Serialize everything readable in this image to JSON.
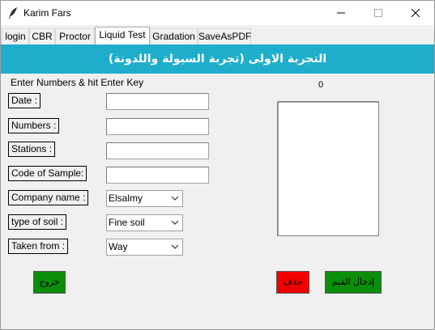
{
  "window": {
    "title": "Karim Fars"
  },
  "tabs": [
    {
      "label": "login",
      "active": false
    },
    {
      "label": "CBR",
      "active": false
    },
    {
      "label": "Proctor",
      "active": false
    },
    {
      "label": "Liquid Test",
      "active": true
    },
    {
      "label": "Gradation",
      "active": false
    },
    {
      "label": "SaveAsPDF",
      "active": false
    }
  ],
  "banner": {
    "text": "التجربة الاولى (تجربة السيولة واللدونة)"
  },
  "form": {
    "hint": "Enter Numbers & hit Enter Key",
    "counter": "0",
    "date_label": "Date :",
    "numbers_label": "Numbers :",
    "stations_label": "Stations :",
    "code_label": "Code of Sample:",
    "company_label": "Company name :",
    "soil_label": "type of soil :",
    "taken_label": "Taken from :",
    "date_value": "",
    "numbers_value": "",
    "stations_value": "",
    "code_value": "",
    "company_value": "Elsalmy",
    "soil_value": "Fine soil",
    "taken_value": "Way"
  },
  "buttons": {
    "exit": "خروج",
    "delete": "حذف",
    "insert": "إدخال القيم"
  },
  "colors": {
    "banner": "#1eaecc",
    "green_button": "#0b8f0b",
    "red_button": "#f20000"
  }
}
